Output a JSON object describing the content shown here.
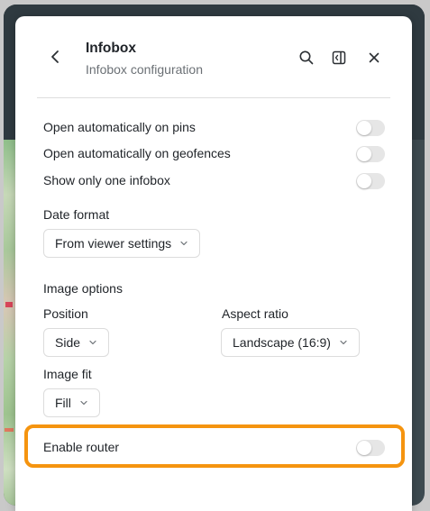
{
  "panel": {
    "title": "Infobox",
    "subtitle": "Infobox configuration"
  },
  "icons": {
    "back": "chevron-left-icon",
    "search": "search-icon",
    "dock": "sidebar-panel-icon",
    "close": "close-icon"
  },
  "toggles": [
    {
      "label": "Open automatically on pins",
      "on": false
    },
    {
      "label": "Open automatically on geofences",
      "on": false
    },
    {
      "label": "Show only one infobox",
      "on": false
    }
  ],
  "date_format": {
    "label": "Date format",
    "value": "From viewer settings"
  },
  "image_options": {
    "heading": "Image options",
    "position_label": "Position",
    "position_value": "Side",
    "aspect_label": "Aspect ratio",
    "aspect_value": "Landscape (16:9)",
    "fit_label": "Image fit",
    "fit_value": "Fill"
  },
  "router": {
    "label": "Enable router",
    "on": false
  },
  "colors": {
    "highlight": "#f5940f",
    "toggle_off": "#e6e6e6"
  }
}
